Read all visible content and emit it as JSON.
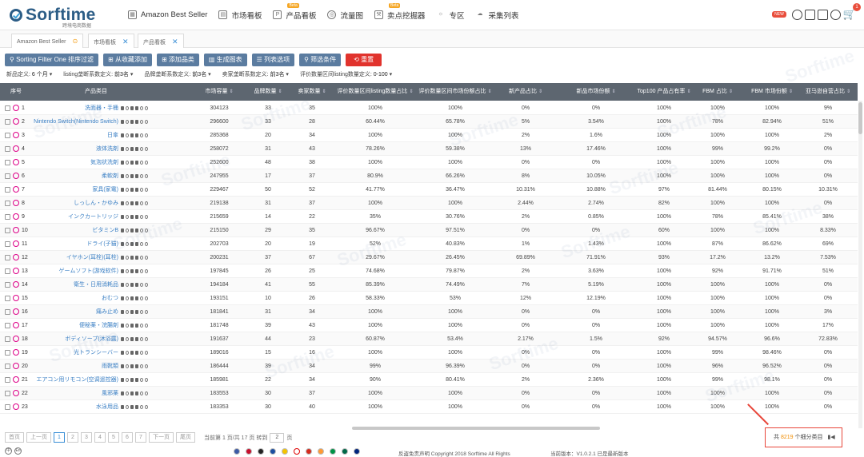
{
  "nav": {
    "logo": "Sorftime",
    "logo_sub": "跨境电商数据",
    "items": [
      {
        "label": "Amazon Best Seller",
        "icon": "grid-icon",
        "beta": ""
      },
      {
        "label": "市场看板",
        "icon": "board-icon",
        "beta": ""
      },
      {
        "label": "产品看板",
        "icon": "product-icon",
        "beta": "Beta"
      },
      {
        "label": "流量图",
        "icon": "traffic-icon",
        "beta": ""
      },
      {
        "label": "卖点挖掘器",
        "icon": "mining-icon",
        "beta": "Beta"
      },
      {
        "label": "专区",
        "icon": "bulb-icon",
        "beta": ""
      },
      {
        "label": "采集列表",
        "icon": "cloud-icon",
        "beta": ""
      }
    ],
    "new_badge": "NEW",
    "cart_count": "1"
  },
  "tabs": [
    {
      "label": "Amazon Best Seller"
    },
    {
      "label": "市场看板"
    },
    {
      "label": "产品看板"
    }
  ],
  "toolbar": {
    "sorting": "Sorting Filter One 排序过滤",
    "from_fav": "从收藏添加",
    "add_cat": "添加品类",
    "gen_chart": "生成图表",
    "list_opts": "列表选项",
    "filter_cond": "筛选条件",
    "reset": "重置"
  },
  "filters": [
    {
      "label": "新品定义:",
      "value": "6 个月"
    },
    {
      "label": "listing垄断系数定义:",
      "value": "前3名"
    },
    {
      "label": "品牌垄断系数定义:",
      "value": "前3名"
    },
    {
      "label": "卖家垄断系数定义:",
      "value": "前3名"
    },
    {
      "label": "评价数量区间listing数量定义:",
      "value": "0-100"
    }
  ],
  "columns": [
    "序号",
    "产品类目",
    "市场容量",
    "品牌数量",
    "卖家数量",
    "评价数量区间listing数量占比",
    "评价数量区间市场份额占比",
    "新产品占比",
    "新品市场份额",
    "Top100 产品占有率",
    "FBM 占比",
    "FBM 市场份额",
    "亚马逊自营占比"
  ],
  "rows": [
    {
      "n": "1",
      "cat": "洗面器・手桶",
      "cap": "304123",
      "brands": "33",
      "sellers": "35",
      "c1": "100%",
      "c2": "100%",
      "c3": "0%",
      "c4": "0%",
      "c5": "100%",
      "c6": "100%",
      "c7": "100%",
      "c8": "9%"
    },
    {
      "n": "2",
      "cat": "Nintendo Switch(Nintendo Switch)",
      "cap": "296600",
      "brands": "33",
      "sellers": "28",
      "c1": "60.44%",
      "c2": "65.78%",
      "c3": "5%",
      "c4": "3.54%",
      "c5": "100%",
      "c6": "78%",
      "c7": "82.94%",
      "c8": "51%"
    },
    {
      "n": "3",
      "cat": "日傘",
      "cap": "285368",
      "brands": "20",
      "sellers": "34",
      "c1": "100%",
      "c2": "100%",
      "c3": "2%",
      "c4": "1.6%",
      "c5": "100%",
      "c6": "100%",
      "c7": "100%",
      "c8": "2%"
    },
    {
      "n": "4",
      "cat": "液体洗剤",
      "cap": "258072",
      "brands": "31",
      "sellers": "43",
      "c1": "78.26%",
      "c2": "59.38%",
      "c3": "13%",
      "c4": "17.46%",
      "c5": "100%",
      "c6": "99%",
      "c7": "99.2%",
      "c8": "0%"
    },
    {
      "n": "5",
      "cat": "気泡状洗剤",
      "cap": "252600",
      "brands": "48",
      "sellers": "38",
      "c1": "100%",
      "c2": "100%",
      "c3": "0%",
      "c4": "0%",
      "c5": "100%",
      "c6": "100%",
      "c7": "100%",
      "c8": "0%"
    },
    {
      "n": "6",
      "cat": "柔軟剤",
      "cap": "247955",
      "brands": "17",
      "sellers": "37",
      "c1": "80.9%",
      "c2": "66.26%",
      "c3": "8%",
      "c4": "10.05%",
      "c5": "100%",
      "c6": "100%",
      "c7": "100%",
      "c8": "0%"
    },
    {
      "n": "7",
      "cat": "家具(家電)",
      "cap": "229467",
      "brands": "50",
      "sellers": "52",
      "c1": "41.77%",
      "c2": "36.47%",
      "c3": "10.31%",
      "c4": "10.88%",
      "c5": "97%",
      "c6": "81.44%",
      "c7": "80.15%",
      "c8": "10.31%"
    },
    {
      "n": "8",
      "cat": "しっしん・かゆみ",
      "cap": "219138",
      "brands": "31",
      "sellers": "37",
      "c1": "100%",
      "c2": "100%",
      "c3": "2.44%",
      "c4": "2.74%",
      "c5": "82%",
      "c6": "100%",
      "c7": "100%",
      "c8": "0%"
    },
    {
      "n": "9",
      "cat": "インクカートリッジ",
      "cap": "215659",
      "brands": "14",
      "sellers": "22",
      "c1": "35%",
      "c2": "30.76%",
      "c3": "2%",
      "c4": "0.85%",
      "c5": "100%",
      "c6": "78%",
      "c7": "85.41%",
      "c8": "38%"
    },
    {
      "n": "10",
      "cat": "ビタミンB",
      "cap": "215150",
      "brands": "29",
      "sellers": "35",
      "c1": "96.67%",
      "c2": "97.51%",
      "c3": "0%",
      "c4": "0%",
      "c5": "60%",
      "c6": "100%",
      "c7": "100%",
      "c8": "8.33%"
    },
    {
      "n": "11",
      "cat": "ドライ(子猫)",
      "cap": "202703",
      "brands": "20",
      "sellers": "19",
      "c1": "52%",
      "c2": "40.83%",
      "c3": "1%",
      "c4": "1.43%",
      "c5": "100%",
      "c6": "87%",
      "c7": "86.62%",
      "c8": "69%"
    },
    {
      "n": "12",
      "cat": "イヤホン(耳栓)(耳栓)",
      "cap": "200231",
      "brands": "37",
      "sellers": "67",
      "c1": "29.67%",
      "c2": "26.45%",
      "c3": "69.89%",
      "c4": "71.91%",
      "c5": "93%",
      "c6": "17.2%",
      "c7": "13.2%",
      "c8": "7.53%"
    },
    {
      "n": "13",
      "cat": "ゲームソフト(游戏软件)",
      "cap": "197845",
      "brands": "26",
      "sellers": "25",
      "c1": "74.68%",
      "c2": "79.87%",
      "c3": "2%",
      "c4": "3.63%",
      "c5": "100%",
      "c6": "92%",
      "c7": "91.71%",
      "c8": "51%"
    },
    {
      "n": "14",
      "cat": "衛生・日用消耗品",
      "cap": "194184",
      "brands": "41",
      "sellers": "55",
      "c1": "85.39%",
      "c2": "74.49%",
      "c3": "7%",
      "c4": "5.19%",
      "c5": "100%",
      "c6": "100%",
      "c7": "100%",
      "c8": "0%"
    },
    {
      "n": "15",
      "cat": "おむつ",
      "cap": "193151",
      "brands": "10",
      "sellers": "26",
      "c1": "58.33%",
      "c2": "53%",
      "c3": "12%",
      "c4": "12.19%",
      "c5": "100%",
      "c6": "100%",
      "c7": "100%",
      "c8": "0%"
    },
    {
      "n": "16",
      "cat": "痛み止め",
      "cap": "181841",
      "brands": "31",
      "sellers": "34",
      "c1": "100%",
      "c2": "100%",
      "c3": "0%",
      "c4": "0%",
      "c5": "100%",
      "c6": "100%",
      "c7": "100%",
      "c8": "3%"
    },
    {
      "n": "17",
      "cat": "便秘薬・浣腸剤",
      "cap": "181748",
      "brands": "39",
      "sellers": "43",
      "c1": "100%",
      "c2": "100%",
      "c3": "0%",
      "c4": "0%",
      "c5": "100%",
      "c6": "100%",
      "c7": "100%",
      "c8": "17%"
    },
    {
      "n": "18",
      "cat": "ボディソープ(沐浴露)",
      "cap": "191637",
      "brands": "44",
      "sellers": "23",
      "c1": "60.87%",
      "c2": "53.4%",
      "c3": "2.17%",
      "c4": "1.5%",
      "c5": "92%",
      "c6": "94.57%",
      "c7": "96.6%",
      "c8": "72.83%"
    },
    {
      "n": "19",
      "cat": "光トランシーバー",
      "cap": "189016",
      "brands": "15",
      "sellers": "16",
      "c1": "100%",
      "c2": "100%",
      "c3": "0%",
      "c4": "0%",
      "c5": "100%",
      "c6": "99%",
      "c7": "98.46%",
      "c8": "0%"
    },
    {
      "n": "20",
      "cat": "雨靴類",
      "cap": "186444",
      "brands": "39",
      "sellers": "34",
      "c1": "99%",
      "c2": "96.39%",
      "c3": "0%",
      "c4": "0%",
      "c5": "100%",
      "c6": "96%",
      "c7": "96.52%",
      "c8": "0%"
    },
    {
      "n": "21",
      "cat": "エアコン用リモコン(空调遥控器)",
      "cap": "185981",
      "brands": "22",
      "sellers": "34",
      "c1": "90%",
      "c2": "80.41%",
      "c3": "2%",
      "c4": "2.36%",
      "c5": "100%",
      "c6": "99%",
      "c7": "98.1%",
      "c8": "0%"
    },
    {
      "n": "22",
      "cat": "風邪薬",
      "cap": "183553",
      "brands": "30",
      "sellers": "37",
      "c1": "100%",
      "c2": "100%",
      "c3": "0%",
      "c4": "0%",
      "c5": "100%",
      "c6": "100%",
      "c7": "100%",
      "c8": "0%"
    },
    {
      "n": "23",
      "cat": "水泳用品",
      "cap": "183353",
      "brands": "30",
      "sellers": "40",
      "c1": "100%",
      "c2": "100%",
      "c3": "0%",
      "c4": "0%",
      "c5": "100%",
      "c6": "100%",
      "c7": "100%",
      "c8": "0%"
    }
  ],
  "pagination": {
    "first": "首页",
    "prev": "上一页",
    "pages": [
      "1",
      "2",
      "3",
      "4",
      "5",
      "6",
      "7"
    ],
    "next": "下一页",
    "last": "尾页",
    "current_info": "当前第 1 页/共 17 页 转到",
    "goto_value": "2",
    "goto_unit": "页",
    "total_prefix": "共",
    "total_count": "8219",
    "total_suffix": "个细分类目"
  },
  "footer": {
    "copyright": "反盗免责声明 Copyright 2018 Sorftime All Rights",
    "version": "当前版本：V1.0.2.1  已是最新版本"
  },
  "watermark": "Sorftime",
  "colors": {
    "brand": "#2c5d86",
    "toolbar_button": "#5b7ca0",
    "reset_button": "#e1332d",
    "table_header": "#5d6670",
    "link": "#3a7fc4",
    "highlight_box": "#e8463a"
  }
}
